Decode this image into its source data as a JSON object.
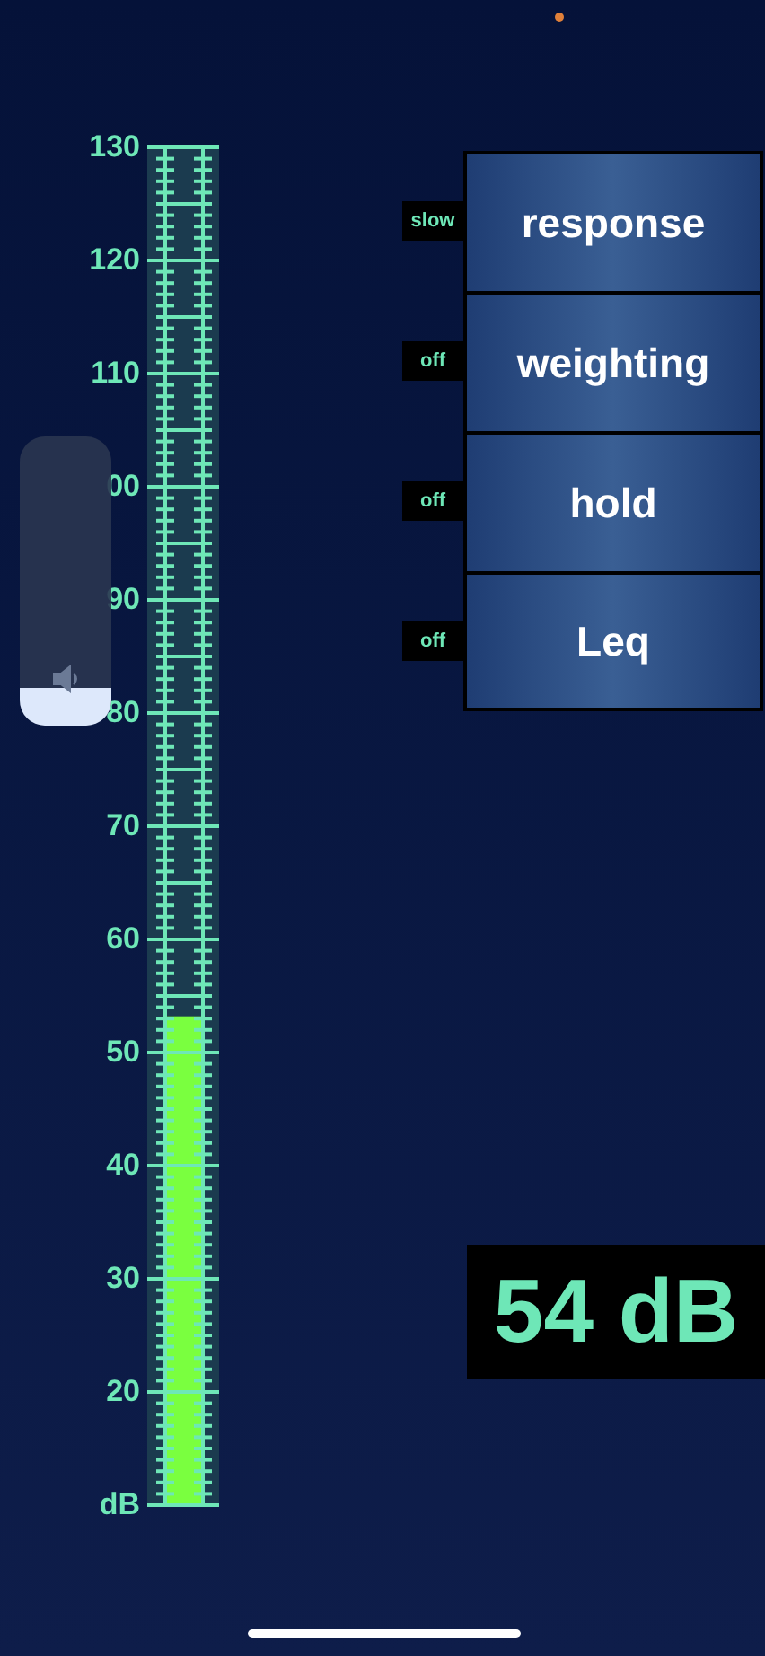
{
  "meter": {
    "scale_labels": [
      "130",
      "120",
      "110",
      "00",
      "90",
      "80",
      "70",
      "60",
      "50",
      "40",
      "30",
      "20",
      "dB"
    ],
    "level": 0.36
  },
  "volume_overlay": {
    "level": 0.13
  },
  "controls": [
    {
      "label": "response",
      "indicator": "slow"
    },
    {
      "label": "weighting",
      "indicator": "off"
    },
    {
      "label": "hold",
      "indicator": "off"
    },
    {
      "label": "Leq",
      "indicator": "off"
    }
  ],
  "readout": "54 dB"
}
